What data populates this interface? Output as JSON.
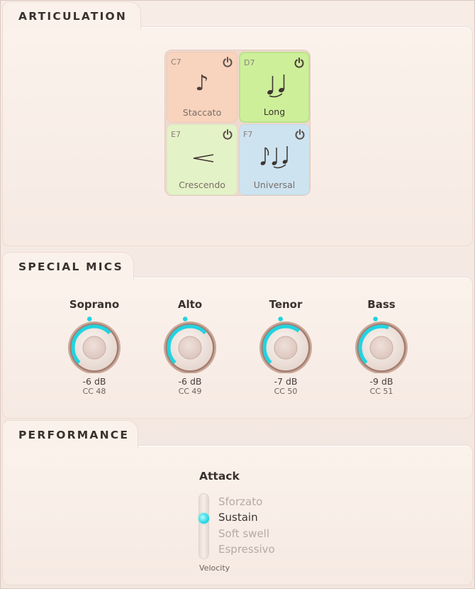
{
  "sections": {
    "articulation": "ARTICULATION",
    "special_mics": "SPECIAL MICS",
    "performance": "PERFORMANCE"
  },
  "articulations": [
    {
      "key": "C7",
      "label": "Staccato",
      "glyph": "♪",
      "color": "#f8d3bd",
      "active": false
    },
    {
      "key": "D7",
      "label": "Long",
      "glyph": "long-notes-icon",
      "color": "#cdef9a",
      "active": true
    },
    {
      "key": "E7",
      "label": "Crescendo",
      "glyph": "crescendo-icon",
      "color": "#e4f2c8",
      "active": false
    },
    {
      "key": "F7",
      "label": "Universal",
      "glyph": "universal-notes-icon",
      "color": "#cde3f0",
      "active": false
    }
  ],
  "mics": [
    {
      "name": "Soprano",
      "value": "-6 dB",
      "cc": "CC 48",
      "level": 0.45
    },
    {
      "name": "Alto",
      "value": "-6 dB",
      "cc": "CC 49",
      "level": 0.45
    },
    {
      "name": "Tenor",
      "value": "-7 dB",
      "cc": "CC 50",
      "level": 0.42
    },
    {
      "name": "Bass",
      "value": "-9 dB",
      "cc": "CC 51",
      "level": 0.35
    }
  ],
  "performance": {
    "attack_title": "Attack",
    "options": [
      "Sforzato",
      "Sustain",
      "Soft swell",
      "Espressivo"
    ],
    "selected": "Sustain",
    "footer": "Velocity"
  },
  "accent_color": "#22d3e0"
}
